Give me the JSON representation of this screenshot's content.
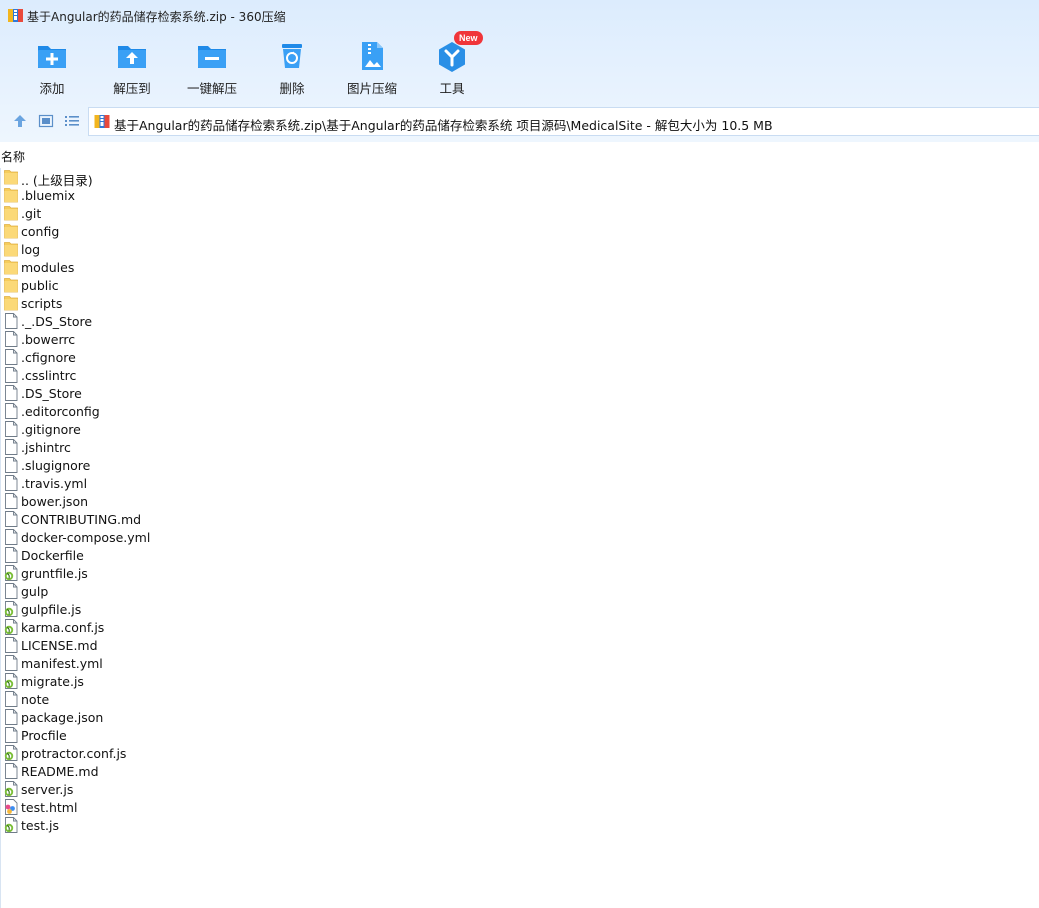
{
  "window": {
    "title": "基于Angular的药品储存检索系统.zip - 360压缩"
  },
  "toolbar": {
    "buttons": [
      {
        "label": "添加",
        "icon": "add-icon"
      },
      {
        "label": "解压到",
        "icon": "extract-to-icon"
      },
      {
        "label": "一键解压",
        "icon": "one-click-extract-icon"
      },
      {
        "label": "删除",
        "icon": "delete-icon"
      },
      {
        "label": "图片压缩",
        "icon": "image-compress-icon"
      },
      {
        "label": "工具",
        "icon": "tools-icon",
        "badge": "New"
      }
    ]
  },
  "address": {
    "path": "基于Angular的药品储存检索系统.zip\\基于Angular的药品储存检索系统 项目源码\\MedicalSite - 解包大小为 10.5 MB"
  },
  "columns": {
    "name": "名称"
  },
  "files": [
    {
      "name": ".. (上级目录)",
      "type": "folder"
    },
    {
      "name": ".bluemix",
      "type": "folder"
    },
    {
      "name": ".git",
      "type": "folder"
    },
    {
      "name": "config",
      "type": "folder"
    },
    {
      "name": "log",
      "type": "folder"
    },
    {
      "name": "modules",
      "type": "folder"
    },
    {
      "name": "public",
      "type": "folder"
    },
    {
      "name": "scripts",
      "type": "folder"
    },
    {
      "name": "._.DS_Store",
      "type": "file"
    },
    {
      "name": ".bowerrc",
      "type": "file"
    },
    {
      "name": ".cfignore",
      "type": "file"
    },
    {
      "name": ".csslintrc",
      "type": "file"
    },
    {
      "name": ".DS_Store",
      "type": "file"
    },
    {
      "name": ".editorconfig",
      "type": "file"
    },
    {
      "name": ".gitignore",
      "type": "file"
    },
    {
      "name": ".jshintrc",
      "type": "file"
    },
    {
      "name": ".slugignore",
      "type": "file"
    },
    {
      "name": ".travis.yml",
      "type": "file"
    },
    {
      "name": "bower.json",
      "type": "file"
    },
    {
      "name": "CONTRIBUTING.md",
      "type": "file"
    },
    {
      "name": "docker-compose.yml",
      "type": "file"
    },
    {
      "name": "Dockerfile",
      "type": "file"
    },
    {
      "name": "gruntfile.js",
      "type": "js"
    },
    {
      "name": "gulp",
      "type": "file"
    },
    {
      "name": "gulpfile.js",
      "type": "js"
    },
    {
      "name": "karma.conf.js",
      "type": "js"
    },
    {
      "name": "LICENSE.md",
      "type": "file"
    },
    {
      "name": "manifest.yml",
      "type": "file"
    },
    {
      "name": "migrate.js",
      "type": "js"
    },
    {
      "name": "note",
      "type": "file"
    },
    {
      "name": "package.json",
      "type": "file"
    },
    {
      "name": "Procfile",
      "type": "file"
    },
    {
      "name": "protractor.conf.js",
      "type": "js"
    },
    {
      "name": "README.md",
      "type": "file"
    },
    {
      "name": "server.js",
      "type": "js"
    },
    {
      "name": "test.html",
      "type": "html"
    },
    {
      "name": "test.js",
      "type": "js"
    }
  ],
  "colors": {
    "accent": "#2a8fe6",
    "folder": "#f6cd5c",
    "badge": "#f0353a"
  }
}
